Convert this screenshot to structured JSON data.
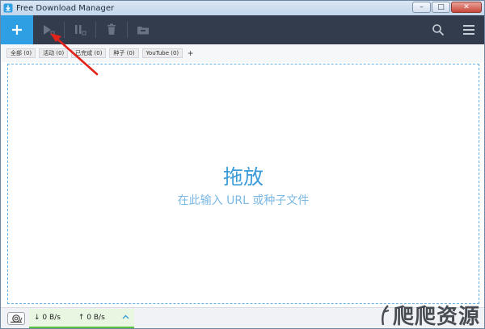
{
  "window": {
    "title": "Free Download Manager",
    "controls": {
      "minimize": "–",
      "maximize": "□",
      "close": "✕"
    }
  },
  "toolbar": {
    "buttons": [
      {
        "name": "add",
        "icon": "plus-icon"
      },
      {
        "name": "start",
        "icon": "play-icon"
      },
      {
        "name": "pause",
        "icon": "pause-icon"
      },
      {
        "name": "delete",
        "icon": "trash-icon"
      },
      {
        "name": "move",
        "icon": "folder-icon"
      }
    ],
    "right": [
      {
        "name": "search",
        "icon": "search-icon"
      },
      {
        "name": "menu",
        "icon": "hamburger-icon"
      }
    ]
  },
  "tabs": [
    {
      "label": "全部 (0)"
    },
    {
      "label": "活动 (0)"
    },
    {
      "label": "已完成 (0)"
    },
    {
      "label": "种子 (0)"
    },
    {
      "label": "YouTube (0)"
    }
  ],
  "tab_add_label": "+",
  "dropzone": {
    "title": "拖放",
    "subtitle": "在此输入 URL 或种子文件"
  },
  "status": {
    "download_speed": "↓ 0 B/s",
    "upload_speed": "↑ 0 B/s"
  },
  "colors": {
    "toolbar_bg": "#333c4d",
    "accent_blue": "#2f9fe3",
    "dropzone_border": "#66b1e6",
    "speed_green": "#58c240",
    "annotation_red": "#e2231a"
  }
}
